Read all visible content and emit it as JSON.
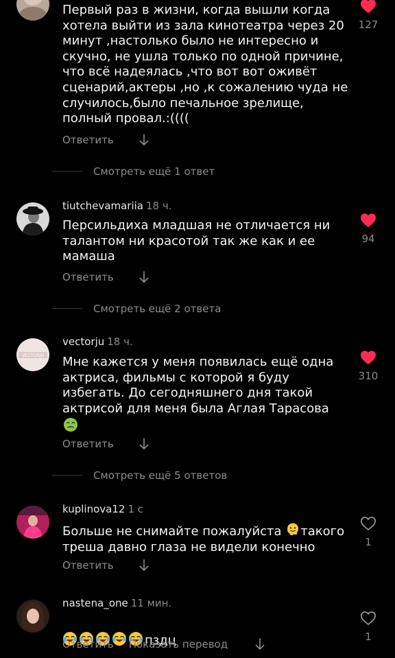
{
  "comments": [
    {
      "username": "",
      "time": "",
      "text": "Первый раз в жизни, когда вышли когда\nхотела выйти из зала кинотеатра через 20\nминут ,настолько было не интересно и\nскучно, не ушла только по одной причине,\nчто всё надеялась ,что вот вот оживёт\nсценарий,актеры ,но ,к сожалению чуда не\nслучилось,было печальное зрелище,\nполный провал.:((((",
      "reply_label": "Ответить",
      "likes": "127",
      "liked": true,
      "more_replies": "Смотреть ещё 1 ответ"
    },
    {
      "username": "tiutchevamariia",
      "time": "18 ч.",
      "text": "Персильдиха младшая не отличается ни\nталантом ни красотой так же как и ее\nмамаша",
      "reply_label": "Ответить",
      "likes": "94",
      "liked": true,
      "more_replies": "Смотреть ещё 2 ответа"
    },
    {
      "username": "vectorju",
      "time": "18 ч.",
      "avatar_text": "VECTORJU",
      "text": "Мне кажется у меня появилась ещё одна\nактриса, фильмы с которой я буду\nизбегать. До сегодняшнего дня такой\nактрисой для меня была Аглая Тарасова",
      "emoji": "nauseated-face-emoji",
      "reply_label": "Ответить",
      "likes": "310",
      "liked": true,
      "more_replies": "Смотреть ещё 5 ответов"
    },
    {
      "username": "kuplinova12",
      "time": "1 с",
      "text_part1": "Больше не снимайте пожалуйста ",
      "text_emoji": "melting-face-emoji",
      "text_part2": "такого\nтреша давно глаза не видели конечно",
      "reply_label": "Ответить",
      "likes": "1",
      "liked": false
    },
    {
      "username": "nastena_one",
      "time": "11 мин.",
      "emoji_row": "face-with-tears-of-joy-emoji",
      "emoji_count": 5,
      "text": "пздц",
      "reply_label": "Ответить",
      "translate_label": "Показать перевод",
      "likes": "1",
      "liked": false
    }
  ],
  "colors": {
    "background": "#000000",
    "like_active": "#ff2b55",
    "text": "#f4f4f4",
    "muted": "#8d8d8d"
  }
}
